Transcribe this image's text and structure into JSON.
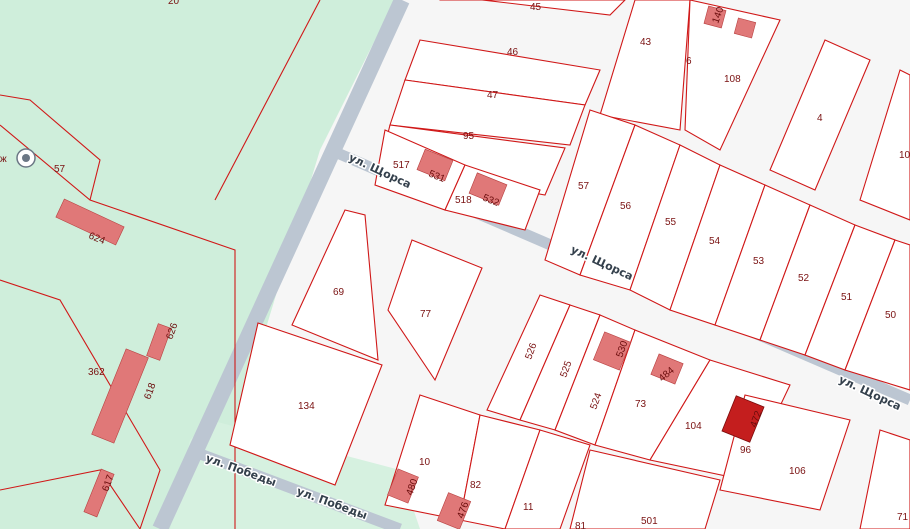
{
  "map": {
    "colors": {
      "background": "#f6f6f6",
      "green_zone": "#cfeedb",
      "parcel_border": "#d01818",
      "building": "#e07878",
      "selected_building": "#c41e1e",
      "road": "#bcc6d2"
    },
    "poi": {
      "icon": "map-pin-icon",
      "label": "ж"
    },
    "streets": {
      "shorsa_1": "ул. Щорса",
      "shorsa_2": "ул. Щорса",
      "shorsa_3": "ул. Щорса",
      "pobedy_1": "ул. Победы",
      "pobedy_2": "ул. Победы"
    },
    "parcels": {
      "p20": "20",
      "p45": "45",
      "p46": "46",
      "p47": "47",
      "p95": "95",
      "p43": "43",
      "p6": "6",
      "p108": "108",
      "p4": "4",
      "p10r": "10",
      "p57a": "57",
      "p517": "517",
      "p518": "518",
      "p57b": "57",
      "p56": "56",
      "p55": "55",
      "p54": "54",
      "p53": "53",
      "p52": "52",
      "p51": "51",
      "p50": "50",
      "p69": "69",
      "p77": "77",
      "p362": "362",
      "p134": "134",
      "p526": "526",
      "p525": "525",
      "p524": "524",
      "p73": "73",
      "p104": "104",
      "p96": "96",
      "p106": "106",
      "p10": "10",
      "p82": "82",
      "p11": "11",
      "p501": "501",
      "p71": "71",
      "p81": "81"
    },
    "buildings": {
      "b140": "140",
      "b531": "531",
      "b532": "532",
      "b624": "624",
      "b626": "626",
      "b618": "618",
      "b617": "617",
      "b530": "530",
      "b484": "484",
      "b472": "472",
      "b480": "480",
      "b476": "476"
    }
  }
}
